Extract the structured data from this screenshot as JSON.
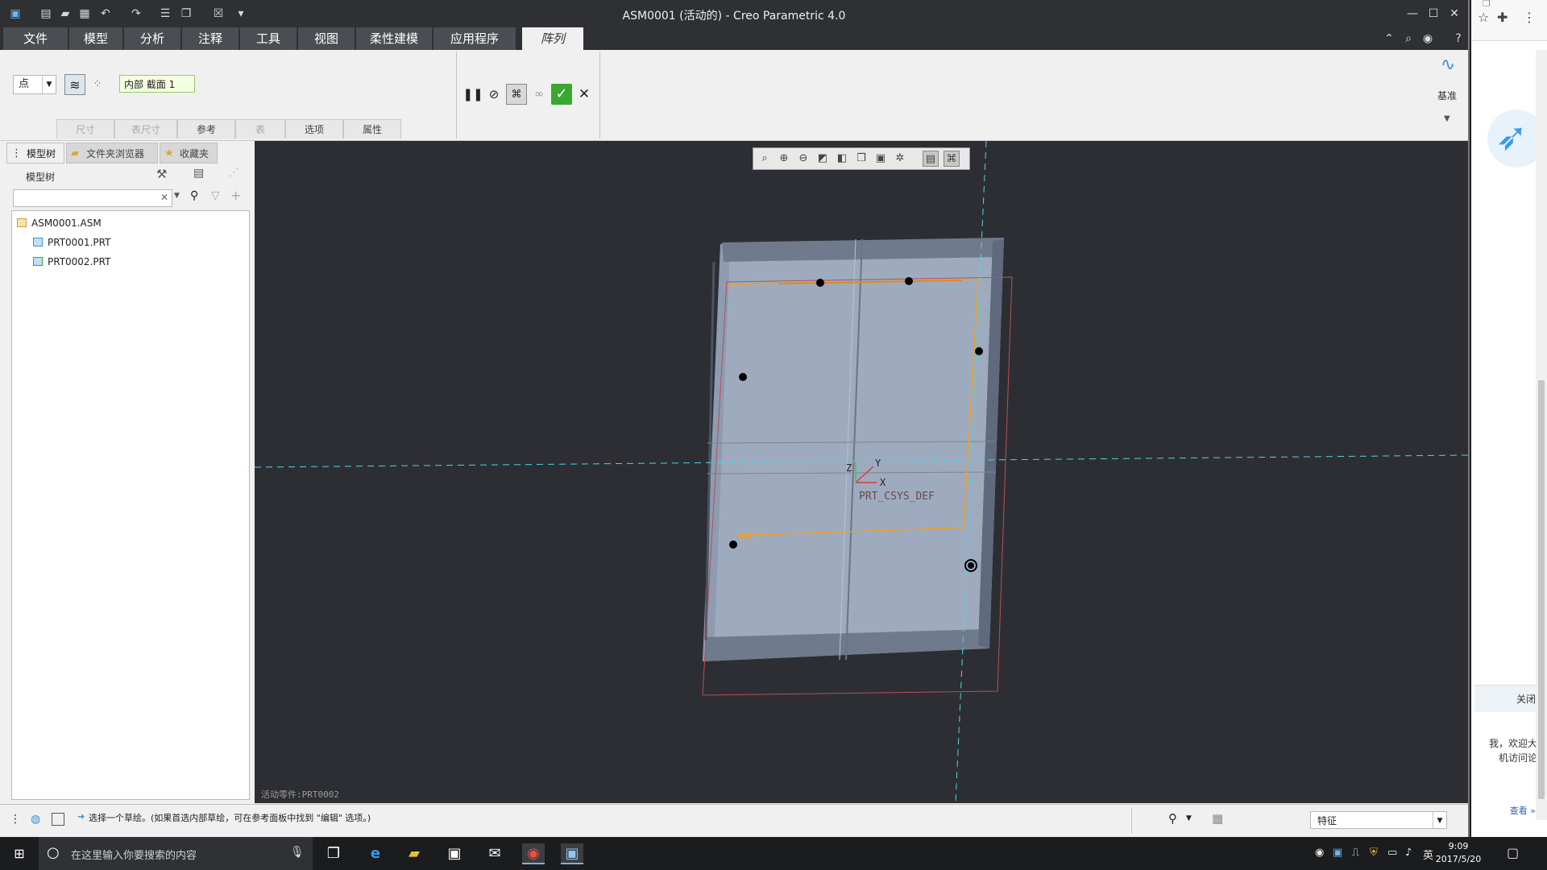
{
  "window": {
    "title": "ASM0001 (活动的) - Creo Parametric 4.0"
  },
  "ribbon_tabs": [
    {
      "label": "文件"
    },
    {
      "label": "模型"
    },
    {
      "label": "分析"
    },
    {
      "label": "注释"
    },
    {
      "label": "工具"
    },
    {
      "label": "视图"
    },
    {
      "label": "柔性建模"
    },
    {
      "label": "应用程序"
    },
    {
      "label": "阵列"
    }
  ],
  "ribbon": {
    "type_dropdown": "点",
    "section_box": "内部 截面 1",
    "subtabs": [
      {
        "label": "尺寸"
      },
      {
        "label": "表尺寸"
      },
      {
        "label": "参考"
      },
      {
        "label": "表"
      },
      {
        "label": "选项"
      },
      {
        "label": "属性"
      }
    ],
    "datum_label": "基准"
  },
  "left_panel": {
    "tabs": [
      {
        "label": "模型树"
      },
      {
        "label": "文件夹浏览器"
      },
      {
        "label": "收藏夹"
      }
    ],
    "tree_label": "模型树",
    "tree": [
      {
        "label": "ASM0001.ASM"
      },
      {
        "label": "PRT0001.PRT"
      },
      {
        "label": "PRT0002.PRT"
      }
    ]
  },
  "viewport": {
    "csys_label": "PRT_CSYS_DEF",
    "axis_x": "X",
    "axis_y": "Y",
    "axis_z": "Z",
    "layer_label": "活动零件:PRT0002"
  },
  "statusbar": {
    "message": "选择一个草绘。(如果首选内部草绘，可在参考面板中找到 \"编辑\" 选项。)",
    "filter": "特征"
  },
  "browser": {
    "close_label": "关闭",
    "welcome_line1": "我，欢迎大",
    "welcome_line2": "机访问论",
    "view_more": "查看 »"
  },
  "taskbar": {
    "search_placeholder": "在这里输入你要搜索的内容",
    "time": "9:09",
    "date": "2017/5/20",
    "ime": "英"
  },
  "colors": {
    "accent_green": "#3aa830",
    "viewport_bg": "#2d2e33",
    "part_face": "#9eabbf",
    "sketch_orange": "#f0a020",
    "datum_cyan": "#48d8e0"
  }
}
